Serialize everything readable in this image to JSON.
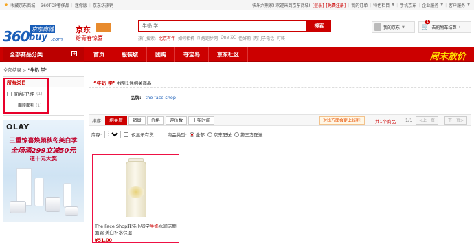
{
  "topbar": {
    "favorite": "收藏京东商城",
    "top_links": [
      "360TOP奢侈品",
      "迷你版",
      "京东坊热销"
    ],
    "welcome": "快乐六熊家! 欢迎来到京东商城!",
    "login": "[登录]",
    "register": "[免费注册]",
    "my_orders": "我的订单",
    "featured": "特色栏目",
    "mobile": "手机京东",
    "enterprise": "企业服务",
    "service": "客户服务"
  },
  "header": {
    "logo_360": "360",
    "logo_buy": "buy",
    "logo_com": ".com",
    "logo_cn": "京东商城",
    "promo_title": "京东",
    "promo_subtitle": "给青春惊喜"
  },
  "search": {
    "value": "牛奶 学",
    "button": "搜索",
    "hot_label": "热门搜索:",
    "hot_words": [
      "北京有年",
      "如何相机",
      "叫醒跑步网",
      "One XC",
      "佳好莉",
      "两门子电话",
      "叮咚"
    ]
  },
  "user": {
    "my_jd": "我的京东",
    "cart": "去购物车结算",
    "cart_count": "1"
  },
  "nav": {
    "all_categories": "全部商品分类",
    "items": [
      "首页",
      "服装城",
      "团购",
      "夺宝岛",
      "京东社区"
    ],
    "weekend": "周末放价"
  },
  "breadcrumb": {
    "root": "全部结果",
    "sep": ">",
    "keyword": "\"牛奶 学\""
  },
  "sidebar": {
    "title": "所有类目",
    "category": "面部护理",
    "category_count": "(1)",
    "sub": "面膜面乳",
    "sub_count": "(1)"
  },
  "ad": {
    "brand": "OLAY",
    "line1": "三重惊喜焕颜秋冬美白季",
    "line2": "全场满299立减50元",
    "line3": "送十元大奖"
  },
  "results": {
    "keyword": "“牛奶 学”",
    "found": "找到1件相关商品",
    "brand_label": "品牌:",
    "brand_value": "the face shop"
  },
  "sort": {
    "label": "排序:",
    "options": [
      "相关度",
      "销量",
      "价格",
      "评价数",
      "上架时间"
    ],
    "notice": "对比方面会更上线啦!",
    "total": "共1个商品",
    "page": "1/1",
    "prev": "<上一页",
    "next": "下一页>"
  },
  "filter": {
    "stock_label": "库存:",
    "region": "湖南",
    "only_in_stock": "仅显示有货",
    "type_label": "商品类型:",
    "types": [
      "全部",
      "京东配送",
      "第三方配送"
    ]
  },
  "product": {
    "name_prefix": "The Face Shop菲诗小铺学",
    "name_highlight": "牛奶",
    "name_suffix": "水润洁颜面霜 美白补水保湿",
    "price": "¥51.00"
  }
}
